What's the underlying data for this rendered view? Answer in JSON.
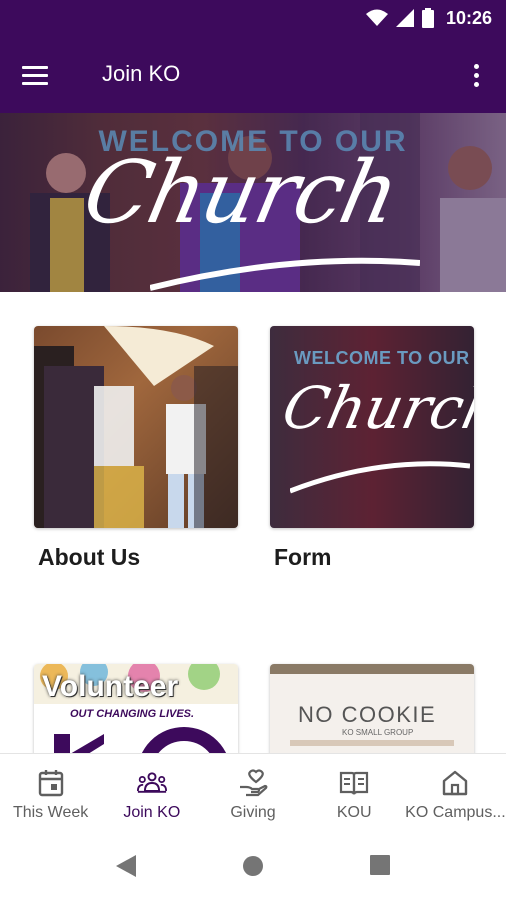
{
  "status_bar": {
    "time": "10:26"
  },
  "app_bar": {
    "title": "Join KO"
  },
  "banner": {
    "welcome": "WELCOME TO OUR",
    "script": "Church"
  },
  "cards": [
    {
      "label": "About Us"
    },
    {
      "label": "Form",
      "overlay_welcome": "WELCOME TO OUR",
      "overlay_script": "Church"
    },
    {
      "label": "",
      "overlay_title": "Volunteer",
      "overlay_subtitle": "OUT CHANGING LIVES."
    },
    {
      "label": "",
      "overlay_title": "NO COOKIE",
      "overlay_subtitle": "KO SMALL GROUP"
    }
  ],
  "bottom_nav": [
    {
      "label": "This Week",
      "icon": "calendar-icon"
    },
    {
      "label": "Join KO",
      "icon": "group-icon",
      "active": true
    },
    {
      "label": "Giving",
      "icon": "giving-hand-icon"
    },
    {
      "label": "KOU",
      "icon": "book-icon"
    },
    {
      "label": "KO Campus...",
      "icon": "home-icon"
    }
  ],
  "colors": {
    "primary": "#3d0a5c",
    "active_nav": "#3d0a5c",
    "inactive_nav": "#5f5f5f"
  }
}
